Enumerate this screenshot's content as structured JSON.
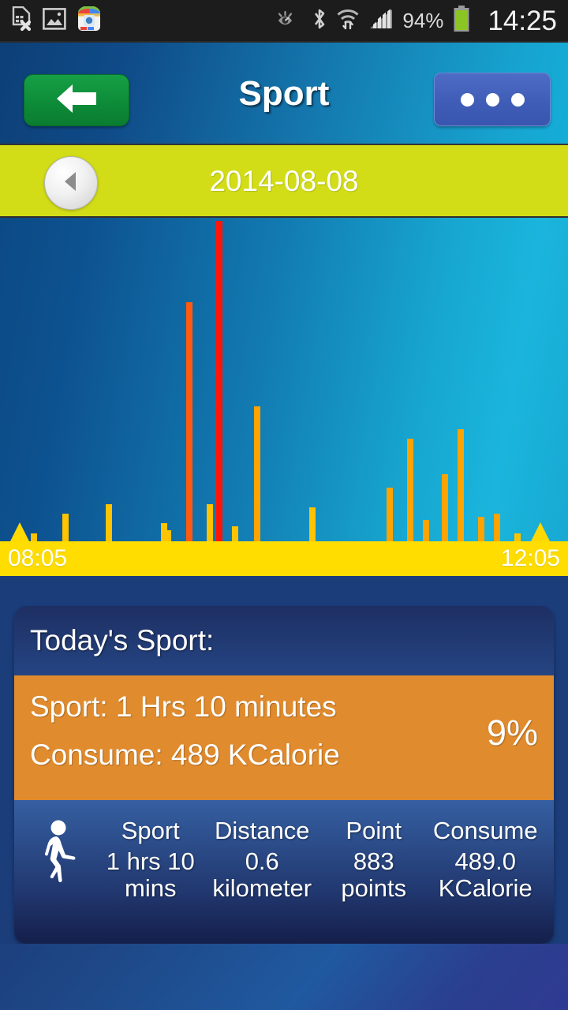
{
  "status_bar": {
    "icons_left": [
      "sim-card-error-icon",
      "photo-gallery-icon",
      "app-store-icon"
    ],
    "icons_right": [
      "smart-stay-eye-icon",
      "bluetooth-icon",
      "wifi-transfer-icon",
      "signal-bars-icon"
    ],
    "battery_percent": "94%",
    "battery_icon": "battery-icon",
    "clock": "14:25"
  },
  "header": {
    "title": "Sport",
    "back_icon": "back-arrow-icon",
    "menu_icon": "overflow-menu-icon",
    "back_color": "#0d8c38",
    "menu_color": "#3e5cb6"
  },
  "date_bar": {
    "date": "2014-08-08",
    "prev_icon": "chevron-left-icon",
    "bar_color": "#d2dd18"
  },
  "chart_data": {
    "type": "bar",
    "title": "",
    "xlabel": "",
    "ylabel": "",
    "grid": false,
    "legend": false,
    "axis_ticks": [
      "08:05",
      "12:05"
    ],
    "xlim": [
      "08:05",
      "12:05"
    ],
    "ylim": [
      0,
      100
    ],
    "colors": {
      "low": "#ffa300",
      "medium": "#ff5a10",
      "high": "#ff1508",
      "marker": "#ffd900",
      "axis_band": "#ffdd00"
    },
    "markers": [
      {
        "x_pct": 3.5,
        "type": "session-start-marker"
      },
      {
        "x_pct": 95.1,
        "type": "session-end-marker"
      }
    ],
    "bars": [
      {
        "x_pct": 11.5,
        "value": 9,
        "color": "#ffc300"
      },
      {
        "x_pct": 19.2,
        "value": 12,
        "color": "#ffc300"
      },
      {
        "x_pct": 28.9,
        "value": 6,
        "color": "#ffc300"
      },
      {
        "x_pct": 33.3,
        "value": 74,
        "color": "#ff5a10"
      },
      {
        "x_pct": 36.9,
        "value": 12,
        "color": "#ffc300"
      },
      {
        "x_pct": 38.6,
        "value": 99,
        "color": "#ff1508"
      },
      {
        "x_pct": 41.4,
        "value": 5,
        "color": "#ffc300"
      },
      {
        "x_pct": 45.3,
        "value": 42,
        "color": "#ffa300"
      },
      {
        "x_pct": 55.0,
        "value": 11,
        "color": "#ffc300"
      },
      {
        "x_pct": 68.6,
        "value": 17,
        "color": "#ffa300"
      },
      {
        "x_pct": 72.2,
        "value": 32,
        "color": "#ffa300"
      },
      {
        "x_pct": 75.0,
        "value": 7,
        "color": "#ffa300"
      },
      {
        "x_pct": 78.3,
        "value": 21,
        "color": "#ffa300"
      },
      {
        "x_pct": 81.1,
        "value": 35,
        "color": "#ffa300"
      },
      {
        "x_pct": 84.7,
        "value": 8,
        "color": "#ffa300"
      },
      {
        "x_pct": 87.5,
        "value": 9,
        "color": "#ffa300"
      },
      {
        "x_pct": 91.1,
        "value": 3,
        "color": "#ffc300"
      },
      {
        "x_pct": 29.6,
        "value": 4,
        "color": "#ffc300"
      },
      {
        "x_pct": 6.0,
        "value": 3,
        "color": "#ffc300"
      }
    ]
  },
  "summary_card": {
    "title": "Today's Sport:",
    "sport_line": "Sport:  1 Hrs 10 minutes",
    "consume_line": "Consume:  489 KCalorie",
    "percent": "9%",
    "panel_color": "#e08b2d"
  },
  "stats_table": {
    "activity_icon": "walking-person-icon",
    "columns": [
      {
        "header": "Sport",
        "value": "1 hrs 10 mins"
      },
      {
        "header": "Distance",
        "value": "0.6 kilometer"
      },
      {
        "header": "Point",
        "value": "883 points"
      },
      {
        "header": "Consume",
        "value": "489.0 KCalorie"
      }
    ]
  }
}
